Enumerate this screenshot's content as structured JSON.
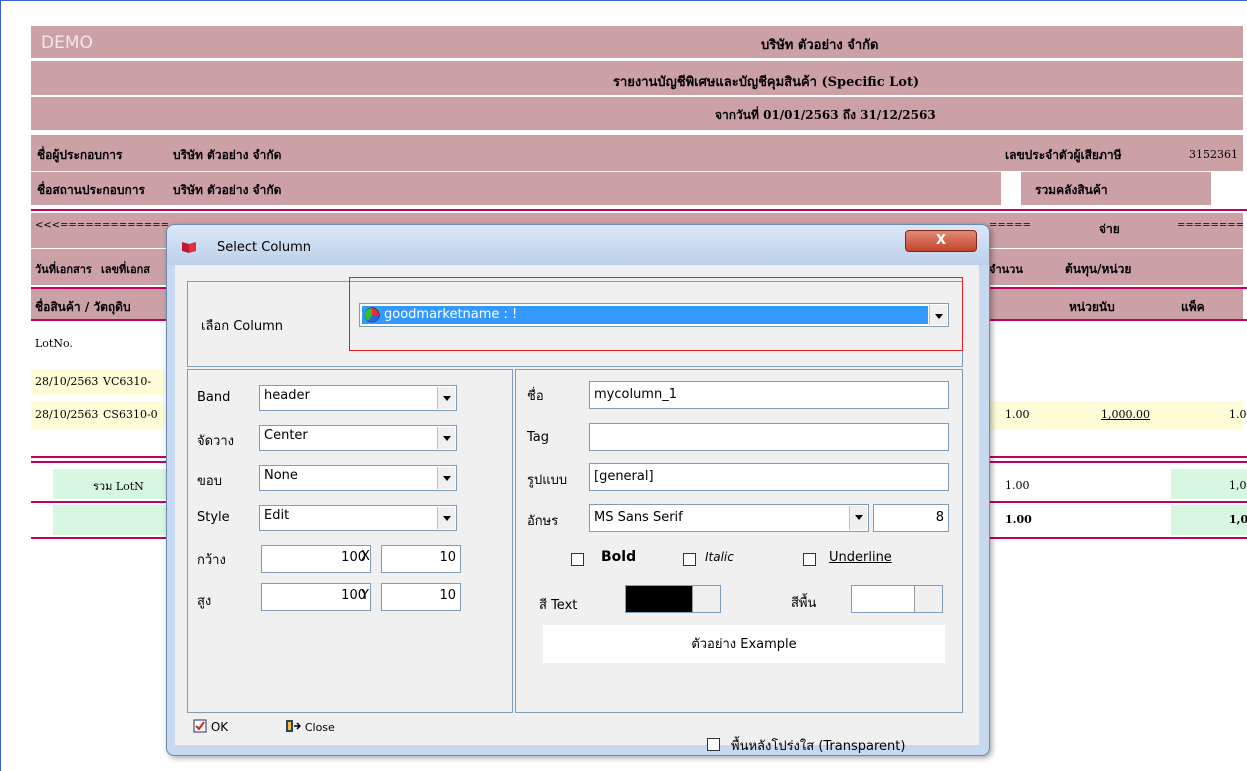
{
  "report": {
    "demo": "DEMO",
    "company": "บริษัท ตัวอย่าง จำกัด",
    "title": "รายงานบัญชีพิเศษและบัญชีคุมสินค้า (Specific Lot)",
    "date_range": "จากวันที่ 01/01/2563 ถึง 31/12/2563",
    "operator_label": "ชื่อผู้ประกอบการ",
    "operator_value": "บริษัท ตัวอย่าง จำกัด",
    "taxid_label": "เลขประจำตัวผู้เสียภาษี",
    "taxid_value": "3152361",
    "place_label": "ชื่อสถานประกอบการ",
    "place_value": "บริษัท ตัวอย่าง จำกัด",
    "warehouse_label": "รวมคลังสินค้า",
    "arrows_left": "<<<=============",
    "arrows_right": "========",
    "arrows_mid": "=====",
    "pay_label": "จ่าย",
    "col_docdate": "วันที่เอกสาร",
    "col_docno": "เลขที่เอกส",
    "col_qty": "จำนวน",
    "col_unitcost": "ต้นทุน/หน่วย",
    "col_product": "ชื่อสินค้า / วัตถุดิบ",
    "col_unit": "หน่วยนับ",
    "col_pack": "แพ็ค",
    "col_lot": "LotNo.",
    "rows": [
      {
        "date": "28/10/2563",
        "doc": "VC6310-",
        "qty": "",
        "cost": "",
        "extra": ""
      },
      {
        "date": "28/10/2563",
        "doc": "CS6310-0",
        "qty": "1.00",
        "cost": "1,000.00",
        "extra": "1.0"
      }
    ],
    "sum_lot_label": "รวม LotN",
    "sum_lot_qty": "1.00",
    "sum_lot_extra": "1,0",
    "total_qty": "1.00",
    "total_extra": "1,0"
  },
  "dialog": {
    "title": "Select Column",
    "close_glyph": "X",
    "column_label": "เลือก Column",
    "column_value": "goodmarketname : !",
    "band_label": "Band",
    "band_value": "header",
    "align_label": "จัดวาง",
    "align_value": "Center",
    "border_label": "ขอบ",
    "border_value": "None",
    "style_label": "Style",
    "style_value": "Edit",
    "width_label": "กว้าง",
    "width_value": "100",
    "x_label": "X",
    "x_value": "10",
    "height_label": "สูง",
    "height_value": "100",
    "y_label": "Y",
    "y_value": "10",
    "name_label": "ชื่อ",
    "name_value": "mycolumn_1",
    "tag_label": "Tag",
    "tag_value": "",
    "format_label": "รูปแบบ",
    "format_value": "[general]",
    "font_label": "อักษร",
    "font_value": "MS Sans Serif",
    "size_value": "8",
    "bold_label": "Bold",
    "italic_label": "Italic",
    "underline_label": "Underline",
    "textcolor_label": "สี Text",
    "bgcolor_label": "สีพื้น",
    "example_text": "ตัวอย่าง Example",
    "ok_label": "OK",
    "close_label": "Close",
    "transparent_label": "พื้นหลังโปร่งใส (Transparent)"
  },
  "colors": {
    "report_band": "#cba1a6",
    "accent_line": "#c2005e",
    "highlight": "#3399ff",
    "focus_border": "#e02020"
  }
}
